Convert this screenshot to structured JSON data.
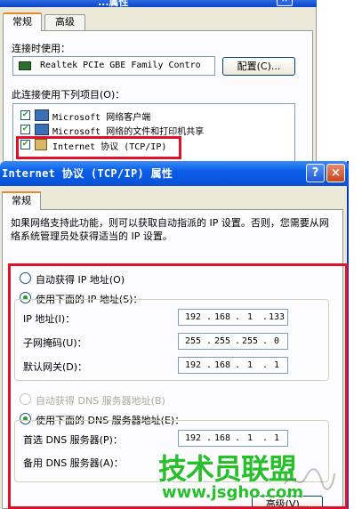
{
  "back_dialog": {
    "title": "...属性",
    "close_glyph": "×",
    "tabs": [
      "常规",
      "高级"
    ],
    "connect_using_label": "连接时使用：",
    "adapter_name": "Realtek PCIe GBE Family Contro",
    "configure_button": "配置(C)...",
    "items_label": "此连接使用下列项目(O)：",
    "components": [
      {
        "label": "Microsoft 网络客户端",
        "checked": true
      },
      {
        "label": "Microsoft 网络的文件和打印机共享",
        "checked": true
      },
      {
        "label": "Internet 协议 (TCP/IP)",
        "checked": true
      }
    ],
    "check_glyph": "✔"
  },
  "front_dialog": {
    "title": "Internet 协议 (TCP/IP) 属性",
    "help_glyph": "?",
    "close_glyph": "×",
    "tab_general": "常规",
    "description": "如果网络支持此功能，则可以获取自动指派的 IP 设置。否则，您需要从网络系统管理员处获得适当的 IP 设置。",
    "auto_ip_label": "自动获得 IP 地址(O)",
    "manual_ip_label": "使用下面的 IP 地址(S)：",
    "ip_selection": "manual",
    "ip_address_label": "IP 地址(I)：",
    "subnet_label": "子网掩码(U)：",
    "gateway_label": "默认网关(D)：",
    "ip_address": [
      "192",
      "168",
      "1",
      "133"
    ],
    "subnet_mask": [
      "255",
      "255",
      "255",
      "0"
    ],
    "default_gateway": [
      "192",
      "168",
      "1",
      "1"
    ],
    "auto_dns_label": "自动获得 DNS 服务器地址(B)",
    "manual_dns_label": "使用下面的 DNS 服务器地址(E)：",
    "dns_selection": "manual",
    "preferred_dns_label": "首选 DNS 服务器(P)：",
    "alternate_dns_label": "备用 DNS 服务器(A)：",
    "preferred_dns": [
      "192",
      "168",
      "1",
      "1"
    ],
    "alternate_dns": [
      "",
      "",
      "",
      ""
    ],
    "advanced_button": "高级(V)...",
    "ip_dot": "."
  },
  "watermark": {
    "brand": "技术员联盟",
    "url": "www.jsgho.com"
  },
  "colors": {
    "highlight_red": "#e0102a",
    "titlebar_blue": "#0b5ee8",
    "watermark_green": "#27c02a"
  }
}
